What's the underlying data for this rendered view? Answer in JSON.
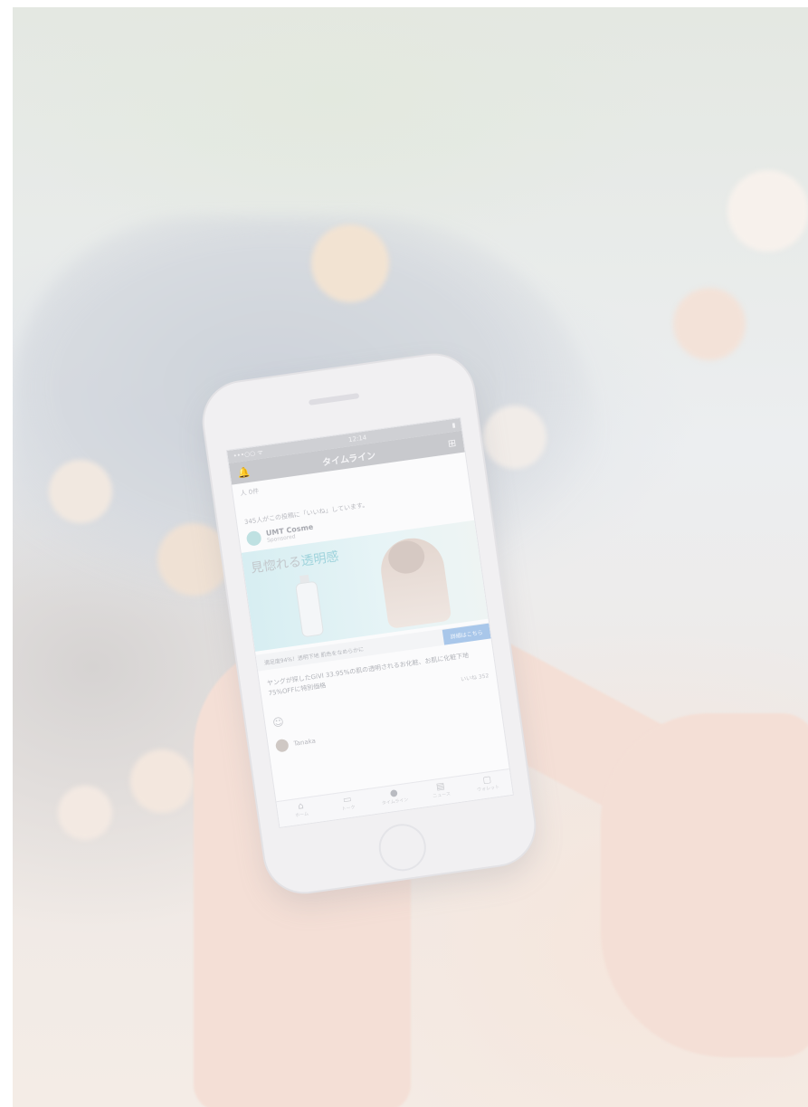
{
  "phone": {
    "status": {
      "carrier": "•••○○ ᯤ",
      "time": "12:14",
      "battery": "▮"
    },
    "nav": {
      "title": "タイムライン",
      "left_icon": "bell-icon",
      "right_icon": "grid-icon"
    },
    "small_note": "人 0件",
    "feed_item": {
      "likes_text": "345人がこの投稿に「いいね」しています。",
      "author_name": "UMT Cosme",
      "author_sub": "Sponsored",
      "ad_headline_prefix": "見惚れる",
      "ad_headline_highlight": "透明感",
      "cta_text": "満足度94%！透明下地 肌色をなめらかに",
      "cta_button": "詳細はこちら",
      "body_text": "ヤングが探したGiVI 33.95%の肌の透明されるお化粧、お肌に化粧下地 75%OFFに特別価格",
      "count_text": "いいね 352",
      "reaction_icon": "smile-icon"
    },
    "next_author": "Tanaka",
    "tabs": [
      {
        "label": "ホーム",
        "icon": "home-icon"
      },
      {
        "label": "トーク",
        "icon": "chat-icon"
      },
      {
        "label": "タイムライン",
        "icon": "timeline-icon"
      },
      {
        "label": "ニュース",
        "icon": "news-icon"
      },
      {
        "label": "ウォレット",
        "icon": "wallet-icon"
      }
    ]
  },
  "colors": {
    "accent_button": "#a9c7ea",
    "avatar_teal": "#bfe1e2"
  }
}
